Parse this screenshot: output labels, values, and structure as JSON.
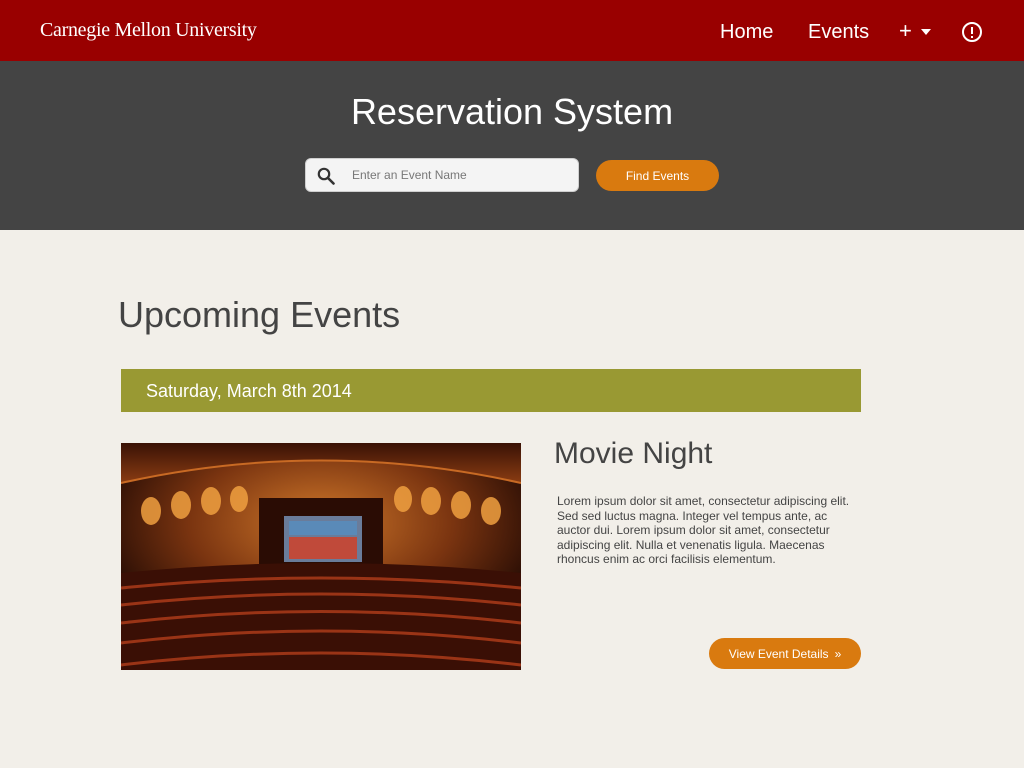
{
  "header": {
    "logo": "Carnegie Mellon University",
    "nav": {
      "home": "Home",
      "events": "Events",
      "add": "+"
    }
  },
  "hero": {
    "title": "Reservation System",
    "search": {
      "placeholder": "Enter an Event Name",
      "value": ""
    },
    "find_button": "Find Events"
  },
  "main": {
    "section_title": "Upcoming Events",
    "groups": [
      {
        "date": "Saturday, March 8th 2014",
        "events": [
          {
            "title": "Movie Night",
            "description": "Lorem ipsum dolor sit amet, consectetur adipiscing elit. Sed sed luctus magna. Integer vel tempus ante, ac auctor dui. Lorem ipsum dolor sit amet, consectetur adipiscing elit. Nulla et venenatis ligula. Maecenas rhoncus enim ac orci facilisis elementum.",
            "details_button": "View Event Details",
            "details_chevron": "»"
          }
        ]
      }
    ]
  },
  "colors": {
    "brand_red": "#990000",
    "hero_gray": "#444444",
    "accent_orange": "#d97a0f",
    "date_olive": "#999933",
    "page_bg": "#f2efe9"
  },
  "icons": [
    "search-icon",
    "plus-icon",
    "caret-down-icon",
    "alert-icon",
    "chevron-right-icon"
  ]
}
